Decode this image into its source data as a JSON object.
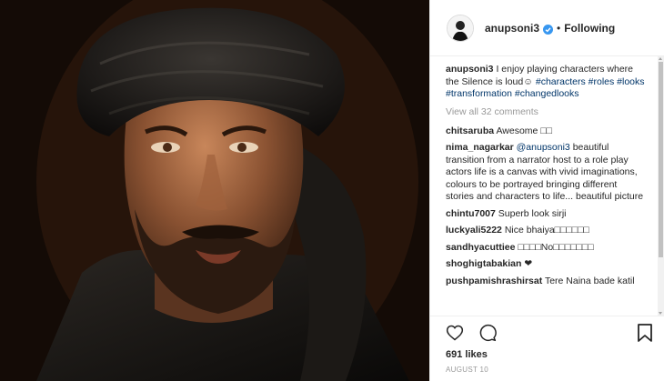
{
  "header": {
    "username": "anupsoni3",
    "separator": "•",
    "follow_status": "Following"
  },
  "caption": {
    "username": "anupsoni3",
    "text": "I enjoy playing characters where the Silence is loud☺",
    "hashtags": "#characters #roles #looks #transformation #changedlooks"
  },
  "view_all_comments": "View all 32 comments",
  "comments": [
    {
      "username": "chitsaruba",
      "text": "Awesome □□"
    },
    {
      "username": "nima_nagarkar",
      "mention": "@anupsoni3",
      "text": "beautiful transition from a narrator host to a role play actors life is a canvas with vivid imaginations, colours to be portrayed bringing different stories and characters to life... beautiful picture"
    },
    {
      "username": "chintu7007",
      "text": "Superb look sirji"
    },
    {
      "username": "luckyali5222",
      "text": "Nice bhaiya□□□□□□"
    },
    {
      "username": "sandhyacuttiee",
      "text": "□□□□No□□□□□□□"
    },
    {
      "username": "shoghigtabakian",
      "text": "❤"
    },
    {
      "username": "pushpamishrashirsat",
      "text": "Tere Naina bade katil"
    }
  ],
  "likes": "691 likes",
  "date": "AUGUST 10",
  "icons": {
    "like": "heart-icon",
    "comment": "comment-icon",
    "save": "bookmark-icon",
    "verified": "verified-badge-icon"
  },
  "colors": {
    "link": "#003569",
    "muted": "#999999",
    "verified": "#3897f0"
  }
}
